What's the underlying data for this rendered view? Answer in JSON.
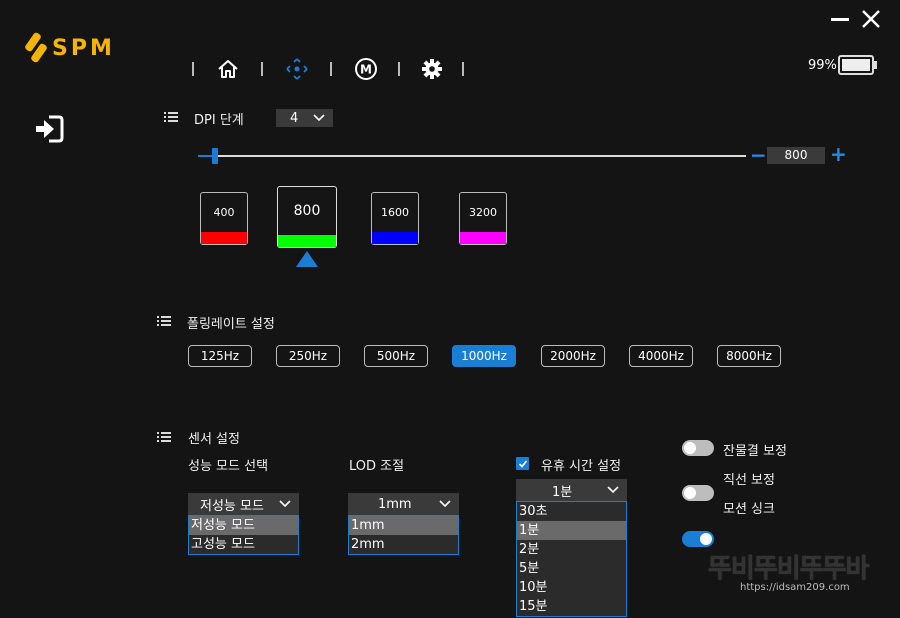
{
  "app": {
    "logo_text": "SPM",
    "brand_color": "#f5b400",
    "accent_color": "#1a7fd4"
  },
  "nav": {
    "icons": [
      "home-icon",
      "move-icon",
      "macro-icon",
      "gear-icon"
    ],
    "macro_letter": "M"
  },
  "battery": {
    "percent": "99%",
    "level": 0.99
  },
  "dpi": {
    "title": "DPI 단계",
    "stage_value": "4",
    "slider_value": "800",
    "minus": "−",
    "plus": "+",
    "stages": [
      {
        "value": "400",
        "color": "#ff0000"
      },
      {
        "value": "800",
        "color": "#00ff00",
        "active": true
      },
      {
        "value": "1600",
        "color": "#0000ff"
      },
      {
        "value": "3200",
        "color": "#ff00ff"
      }
    ]
  },
  "polling": {
    "title": "폴링레이트 설정",
    "options": [
      "125Hz",
      "250Hz",
      "500Hz",
      "1000Hz",
      "2000Hz",
      "4000Hz",
      "8000Hz"
    ],
    "selected": "1000Hz"
  },
  "sensor": {
    "title": "센서 설정",
    "performance_mode": {
      "label": "성능 모드 선택",
      "value": "저성능 모드",
      "options": [
        "저성능 모드",
        "고성능 모드"
      ]
    },
    "lod": {
      "label": "LOD 조절",
      "value": "1mm",
      "options": [
        "1mm",
        "2mm"
      ]
    },
    "idle_time": {
      "label": "유휴 시간 설정",
      "checked": true,
      "value": "1분",
      "options": [
        "30초",
        "1분",
        "2분",
        "5분",
        "10분",
        "15분"
      ]
    },
    "toggles": [
      {
        "label": "잔물결 보정",
        "on": false
      },
      {
        "label": "직선 보정",
        "on": false
      },
      {
        "label": "모션 싱크",
        "on": true
      }
    ]
  },
  "watermark": {
    "title": "뚜비뚜비뚜뚜바",
    "url": "https://idsam209.com"
  }
}
